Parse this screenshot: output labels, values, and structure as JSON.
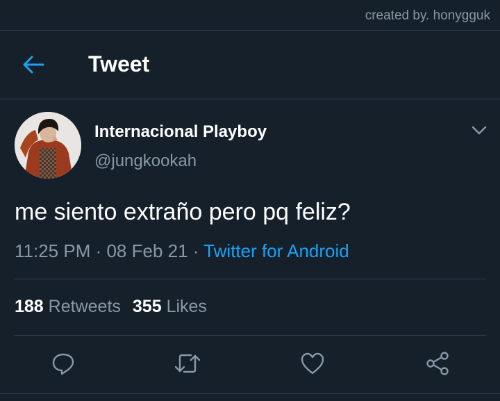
{
  "credit": "created by. honygguk",
  "header": {
    "title": "Tweet"
  },
  "author": {
    "display_name": "Internacional Playboy",
    "handle": "@jungkookah"
  },
  "tweet": {
    "text": "me siento extraño pero pq feliz?",
    "time": "11:25 PM",
    "date": "08 Feb 21",
    "source": "Twitter for Android",
    "separator": " · "
  },
  "stats": {
    "retweets_count": "188",
    "retweets_label": "Retweets",
    "likes_count": "355",
    "likes_label": "Likes"
  },
  "icons": {
    "back": "arrow-left-icon",
    "more": "chevron-down-icon",
    "reply": "reply-icon",
    "retweet": "retweet-icon",
    "like": "heart-icon",
    "share": "share-icon"
  },
  "colors": {
    "background": "#16202b",
    "accent": "#1da1f2",
    "secondary_text": "#8899a6",
    "divider": "#2f3d4b"
  }
}
